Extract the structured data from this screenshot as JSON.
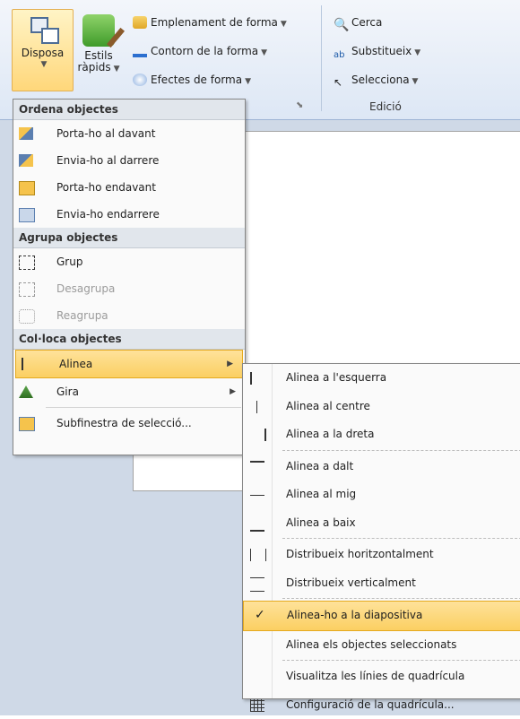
{
  "ribbon": {
    "dispose_label": "Disposa",
    "estils_label": "Estils",
    "estils_sub": "ràpids",
    "emplenament": "Emplenament de forma",
    "contorn": "Contorn de la forma",
    "efectes": "Efectes de forma",
    "cerca": "Cerca",
    "substitueix": "Substitueix",
    "selecciona": "Selecciona",
    "edicio": "Edició"
  },
  "menu": {
    "h1": "Ordena objectes",
    "portaDavant": "Porta-ho al davant",
    "enviaDarrere": "Envia-ho al darrere",
    "portaEndavant": "Porta-ho endavant",
    "enviaEndarrere": "Envia-ho endarrere",
    "h2": "Agrupa objectes",
    "grup": "Grup",
    "desagrupa": "Desagrupa",
    "reagrupa": "Reagrupa",
    "h3": "Col·loca objectes",
    "alinea": "Alinea",
    "gira": "Gira",
    "subfinestra": "Subfinestra de selecció..."
  },
  "submenu": {
    "esquerra": "Alinea a l'esquerra",
    "centre": "Alinea al centre",
    "dreta": "Alinea a la dreta",
    "dalt": "Alinea a dalt",
    "mig": "Alinea al mig",
    "baix": "Alinea a baix",
    "hor": "Distribueix horitzontalment",
    "ver": "Distribueix verticalment",
    "diapositiva": "Alinea-ho a la diapositiva",
    "seleccionats": "Alinea els objectes seleccionats",
    "linies": "Visualitza les línies de quadrícula",
    "config": "Configuració de la quadrícula..."
  },
  "icons": [
    "dispose-icon",
    "estils-icon",
    "fill-icon",
    "outline-icon",
    "effects-icon",
    "binoculars-icon",
    "replace-icon",
    "select-arrow-icon",
    "check-icon",
    "grid-icon"
  ],
  "colors": {
    "highlight": "#fbcf62",
    "ribbon": "#dde7f5"
  }
}
